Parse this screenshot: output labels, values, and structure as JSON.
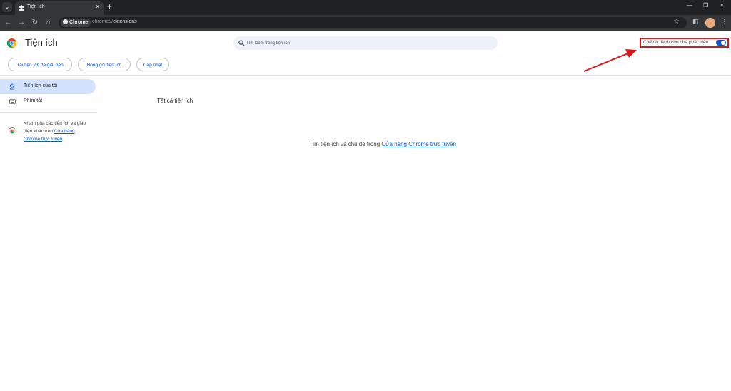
{
  "browser": {
    "tab_title": "Tiện ích",
    "tab_close": "✕",
    "new_tab": "+",
    "chip_label": "Chrome",
    "url_scheme": "chrome://",
    "url_path": "extensions",
    "window_controls": [
      "—",
      "❐",
      "✕"
    ]
  },
  "header": {
    "title": "Tiện ích",
    "search_placeholder": "Tìm kiếm trong tiện ích",
    "devmode_label": "Chế độ dành cho nhà phát triển",
    "devmode_on": true
  },
  "actions": [
    "Tải tiện ích đã giải nén",
    "Đóng gói tiện ích",
    "Cập nhật"
  ],
  "sidebar": {
    "items": [
      {
        "label": "Tiện ích của tôi",
        "selected": true
      },
      {
        "label": "Phím tắt",
        "selected": false
      }
    ],
    "store_text_prefix": "Khám phá các tiện ích và giao diện khác trên ",
    "store_link": "Cửa hàng Chrome trực tuyến"
  },
  "main": {
    "section_title": "Tất cả tiện ích",
    "empty_text": "Tìm tiện ích và chủ đề trong ",
    "empty_link": "Cửa hàng Chrome trực tuyến"
  },
  "colors": {
    "accent": "#0b57d0",
    "highlight_box": "#e0131b",
    "selected_bg": "#d3e3fd"
  }
}
